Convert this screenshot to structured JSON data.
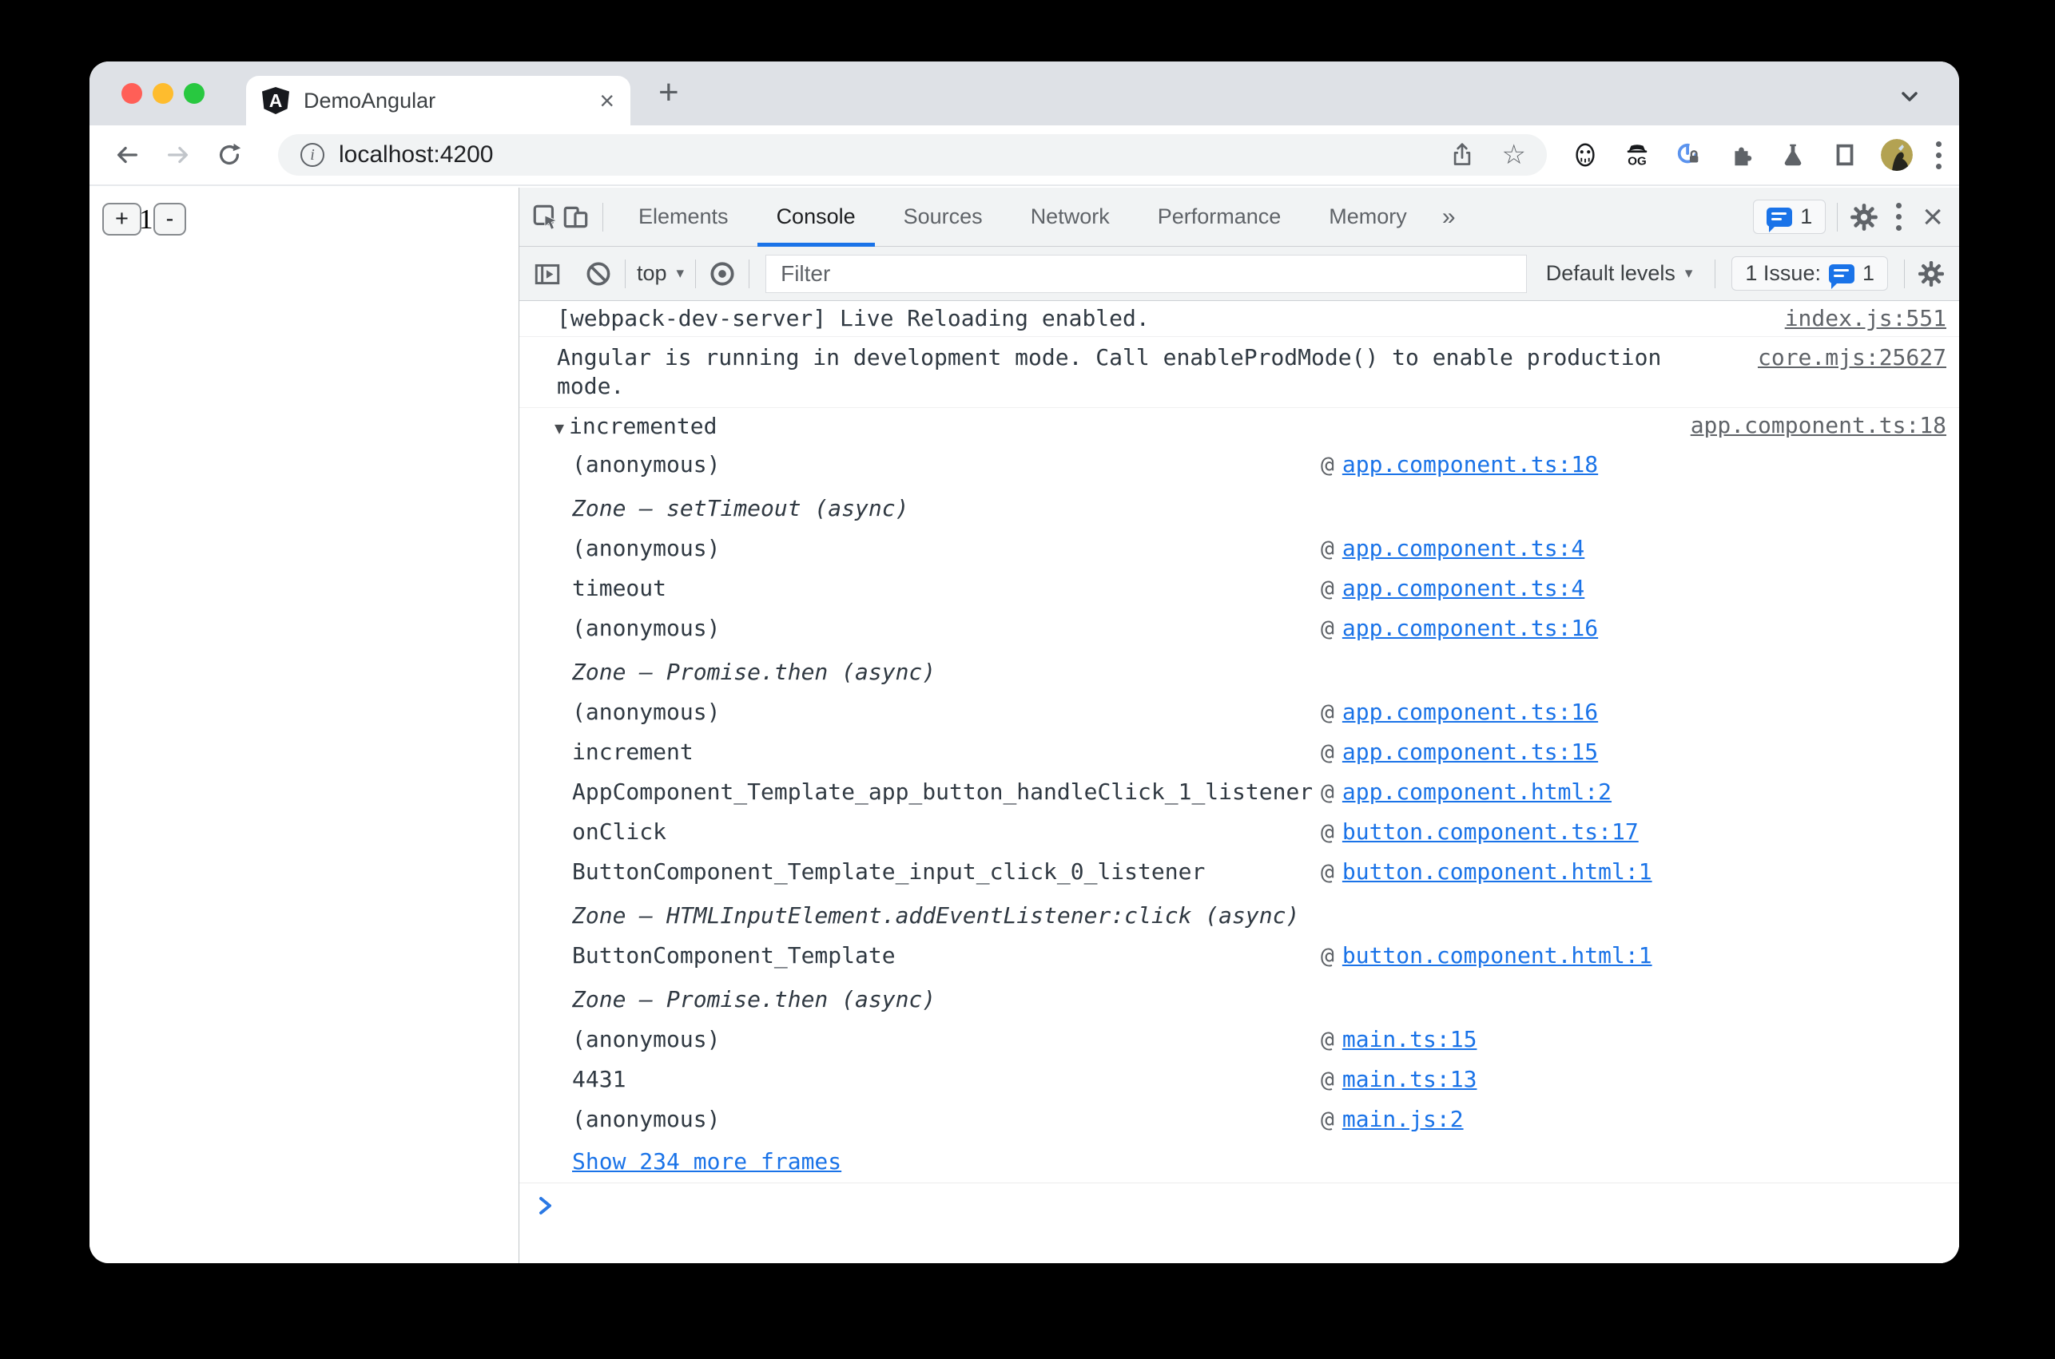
{
  "colors": {
    "accent_blue": "#1a73e8",
    "link_blue": "#1a73e8",
    "source_gray": "#5f6368",
    "traffic_red": "#ff5f57",
    "traffic_yellow": "#febc2e",
    "traffic_green": "#28c840",
    "tabstrip_gray": "#dee1e6",
    "devtools_toolbar_gray": "#f1f3f4"
  },
  "icons": {
    "angular_letter": "A",
    "star": "☆",
    "tab_close": "×",
    "devtools_close": "×",
    "new_tab": "+",
    "dropdown_caret": "▾",
    "overflow_chevrons": "»",
    "trace_expander": "▼",
    "info_letter": "i"
  },
  "browser": {
    "tab": {
      "title": "DemoAngular"
    },
    "address": {
      "url": "localhost:4200"
    }
  },
  "page": {
    "increment_label": "+",
    "counter_value": "1",
    "decrement_label": "-"
  },
  "devtools": {
    "tabs": {
      "elements": "Elements",
      "console": "Console",
      "sources": "Sources",
      "network": "Network",
      "performance": "Performance",
      "memory": "Memory"
    },
    "tabbar_issue_count": "1",
    "console_toolbar": {
      "context": "top",
      "filter_placeholder": "Filter",
      "levels_label": "Default levels",
      "issues_label": "1 Issue:",
      "issues_count": "1"
    },
    "console": {
      "at": "@",
      "messages": [
        {
          "text": "[webpack-dev-server] Live Reloading enabled.",
          "source": "index.js:551"
        },
        {
          "text": "Angular is running in development mode. Call enableProdMode() to enable production mode.",
          "source": "core.mjs:25627"
        }
      ],
      "trace": {
        "label": "incremented",
        "source": "app.component.ts:18",
        "frames": [
          {
            "name": "(anonymous)",
            "link": "app.component.ts:18"
          },
          {
            "name": "Zone – setTimeout (async)"
          },
          {
            "name": "(anonymous)",
            "link": "app.component.ts:4"
          },
          {
            "name": "timeout",
            "link": "app.component.ts:4"
          },
          {
            "name": "(anonymous)",
            "link": "app.component.ts:16"
          },
          {
            "name": "Zone – Promise.then (async)"
          },
          {
            "name": "(anonymous)",
            "link": "app.component.ts:16"
          },
          {
            "name": "increment",
            "link": "app.component.ts:15"
          },
          {
            "name": "AppComponent_Template_app_button_handleClick_1_listener",
            "link": "app.component.html:2"
          },
          {
            "name": "onClick",
            "link": "button.component.ts:17"
          },
          {
            "name": "ButtonComponent_Template_input_click_0_listener",
            "link": "button.component.html:1"
          },
          {
            "name": "Zone – HTMLInputElement.addEventListener:click (async)"
          },
          {
            "name": "ButtonComponent_Template",
            "link": "button.component.html:1"
          },
          {
            "name": "Zone – Promise.then (async)"
          },
          {
            "name": "(anonymous)",
            "link": "main.ts:15"
          },
          {
            "name": "4431",
            "link": "main.ts:13"
          },
          {
            "name": "(anonymous)",
            "link": "main.js:2"
          }
        ],
        "show_more": "Show 234 more frames"
      }
    }
  }
}
